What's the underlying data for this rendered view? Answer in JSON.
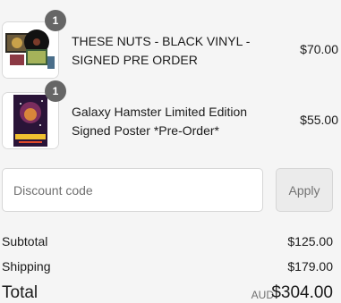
{
  "line_items": [
    {
      "quantity": "1",
      "title": "THESE NUTS - BLACK VINYL - SIGNED PRE ORDER",
      "price": "$70.00",
      "image_alt_icon": "vinyl-record-product-image"
    },
    {
      "quantity": "1",
      "title": "Galaxy Hamster Limited Edition Signed Poster *Pre-Order*",
      "price": "$55.00",
      "image_alt_icon": "poster-product-image"
    }
  ],
  "discount": {
    "placeholder": "Discount code",
    "value": "",
    "apply_label": "Apply"
  },
  "summary": {
    "subtotal_label": "Subtotal",
    "subtotal_value": "$125.00",
    "shipping_label": "Shipping",
    "shipping_value": "$179.00",
    "total_label": "Total",
    "currency": "AUD",
    "total_value": "$304.00"
  },
  "colors": {
    "background": "#f5f5f5",
    "badge": "#666666",
    "text": "#1a1a1a",
    "muted": "#707070"
  }
}
